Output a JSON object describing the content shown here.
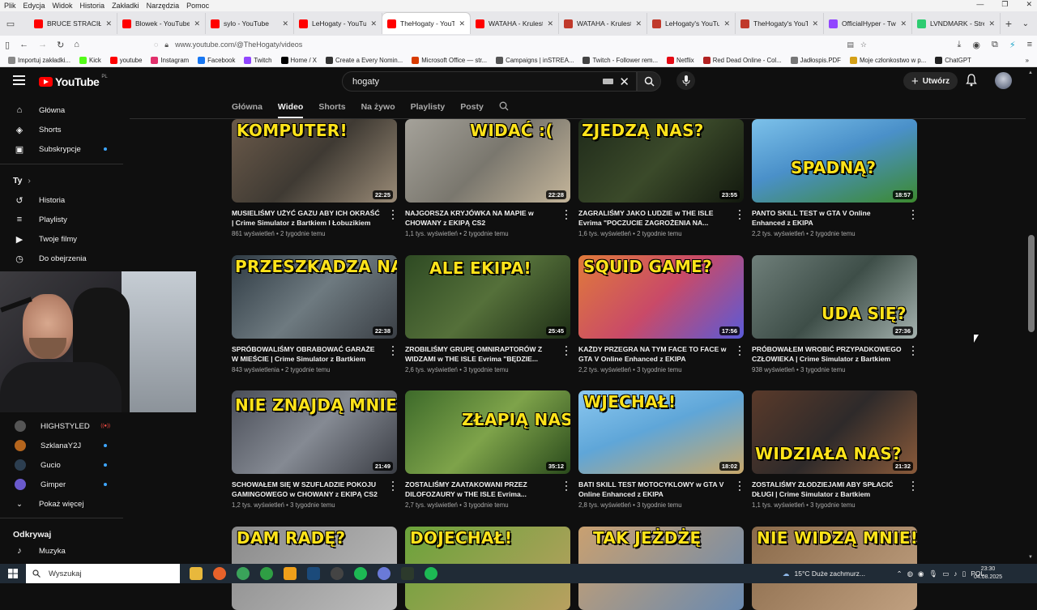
{
  "menubar": {
    "items": [
      "Plik",
      "Edycja",
      "Widok",
      "Historia",
      "Zakładki",
      "Narzędzia",
      "Pomoc"
    ]
  },
  "browser": {
    "tabs": [
      {
        "title": "BRUCE STRACIŁ KAS",
        "color": "#ff0000"
      },
      {
        "title": "Blowek - YouTube",
        "color": "#ff0000"
      },
      {
        "title": "sylo - YouTube",
        "color": "#ff0000"
      },
      {
        "title": "LeHogaty - YouTube",
        "color": "#ff0000"
      },
      {
        "title": "TheHogaty - YouTube",
        "color": "#ff0000",
        "active": true
      },
      {
        "title": "WATAHA - Krulestw",
        "color": "#ff0000"
      },
      {
        "title": "WATAHA - Krulestw",
        "color": "#c0392b"
      },
      {
        "title": "LeHogaty's YouTube",
        "color": "#c0392b"
      },
      {
        "title": "TheHogaty's YouTub",
        "color": "#c0392b"
      },
      {
        "title": "OfficialHyper - Twit",
        "color": "#9146ff"
      },
      {
        "title": "LVNDMARK - Strea",
        "color": "#2ecc71"
      }
    ],
    "url": "www.youtube.com/@TheHogaty/videos",
    "bookmarks": [
      {
        "label": "Importuj zakładki...",
        "color": "#888"
      },
      {
        "label": "Kick",
        "color": "#53fc18"
      },
      {
        "label": "youtube",
        "color": "#ff0000"
      },
      {
        "label": "Instagram",
        "color": "#e1306c"
      },
      {
        "label": "Facebook",
        "color": "#1877f2"
      },
      {
        "label": "Twitch",
        "color": "#9146ff"
      },
      {
        "label": "Home / X",
        "color": "#000000"
      },
      {
        "label": "Create a Every Nomin...",
        "color": "#333"
      },
      {
        "label": "Microsoft Office — str...",
        "color": "#d83b01"
      },
      {
        "label": "Campaigns | inSTREA...",
        "color": "#555"
      },
      {
        "label": "Twitch - Follower rem...",
        "color": "#444"
      },
      {
        "label": "Netflix",
        "color": "#e50914"
      },
      {
        "label": "Red Dead Online - Col...",
        "color": "#b22222"
      },
      {
        "label": "Jadłospis.PDF",
        "color": "#777"
      },
      {
        "label": "Moje członkostwo w p...",
        "color": "#d4a017"
      },
      {
        "label": "ChatGPT",
        "color": "#222"
      }
    ]
  },
  "youtube": {
    "logo_word": "YouTube",
    "logo_country": "PL",
    "search_value": "hogaty",
    "create_label": "Utwórz",
    "accent": "#ff0000"
  },
  "sidebar": {
    "main": [
      {
        "label": "Główna",
        "icon": "home-icon"
      },
      {
        "label": "Shorts",
        "icon": "shorts-icon"
      },
      {
        "label": "Subskrypcje",
        "icon": "subscriptions-icon",
        "dot": true
      }
    ],
    "you_heading": "Ty",
    "you": [
      {
        "label": "Historia",
        "icon": "history-icon"
      },
      {
        "label": "Playlisty",
        "icon": "playlists-icon"
      },
      {
        "label": "Twoje filmy",
        "icon": "your-videos-icon"
      },
      {
        "label": "Do obejrzenia",
        "icon": "watch-later-icon"
      }
    ],
    "channels": [
      {
        "label": "HIGHSTYLED",
        "live": true,
        "color": "#555"
      },
      {
        "label": "SzklanaY2J",
        "dot": true,
        "color": "#b5651d"
      },
      {
        "label": "Gucio",
        "dot": true,
        "color": "#2c3e50"
      },
      {
        "label": "Gimper",
        "dot": true,
        "color": "#6a5acd"
      }
    ],
    "more_label": "Pokaż więcej",
    "explore_heading": "Odkrywaj",
    "explore": [
      {
        "label": "Muzyka",
        "icon": "music-icon"
      }
    ]
  },
  "channel_tabs": [
    "Główna",
    "Wideo",
    "Shorts",
    "Na żywo",
    "Playlisty",
    "Posty"
  ],
  "videos": [
    {
      "caption": "KOMPUTER!",
      "duration": "22:25",
      "title": "MUSIELIŚMY UŻYĆ GAZU ABY ICH OKRAŚĆ | Crime Simulator z Bartkiem I Łobuzikiem",
      "views": "861 wyświetleń",
      "age": "2 tygodnie temu",
      "bg": "linear-gradient(135deg,#6b5a4a,#3f3a33 50%,#9a8b77)"
    },
    {
      "caption": "WIDAĆ :(",
      "duration": "22:28",
      "title": "NAJGORSZA KRYJÓWKA NA MAPIE w CHOWANY z EKIPĄ CS2",
      "views": "1,1 tys. wyświetleń",
      "age": "2 tygodnie temu",
      "bg": "linear-gradient(135deg,#a5a29a,#7a776e 50%,#c4b59a)"
    },
    {
      "caption": "ZJEDZĄ NAS?",
      "duration": "23:55",
      "title": "ZAGRALIŚMY JAKO LUDZIE w THE ISLE Evrima \"POCZUCIE ZAGROŻENIA NA...",
      "views": "1,6 tys. wyświetleń",
      "age": "2 tygodnie temu",
      "bg": "linear-gradient(135deg,#1f2a1a,#3b4a2a 50%,#12180e)"
    },
    {
      "caption": "SPADNĄ?",
      "duration": "18:57",
      "title": "PANTO SKILL TEST w GTA V Online Enhanced z EKIPA",
      "views": "2,2 tys. wyświetleń",
      "age": "2 tygodnie temu",
      "bg": "linear-gradient(160deg,#7cc1ea,#4a90c9 45%,#3c8a2e)"
    },
    {
      "caption": "PRZESZKADZA NAM!",
      "duration": "22:38",
      "title": "SPRÓBOWALIŚMY OBRABOWAĆ GARAŻE W MIEŚCIE | Crime Simulator z Bartkiem",
      "views": "843 wyświetlenia",
      "age": "2 tygodnie temu",
      "bg": "linear-gradient(135deg,#2f3b44,#6e7a80 50%,#3a3f45)"
    },
    {
      "caption": "ALE EKIPA!",
      "duration": "25:45",
      "title": "ZROBILIŚMY GRUPĘ OMNIRAPTORÓW Z WIDZAMI w THE ISLE Evrima \"BĘDZIE...",
      "views": "2,6 tys. wyświetleń",
      "age": "3 tygodnie temu",
      "bg": "linear-gradient(135deg,#2e4a23,#55703a 50%,#1e2e16)"
    },
    {
      "caption": "SQUID GAME?",
      "duration": "17:56",
      "title": "KAŻDY PRZEGRA NA TYM FACE TO FACE w GTA V Online Enhanced z EKIPA",
      "views": "2,2 tys. wyświetleń",
      "age": "3 tygodnie temu",
      "bg": "linear-gradient(135deg,#e07a3a,#c94a68 50%,#5a5ad8)"
    },
    {
      "caption": "UDA SIĘ?",
      "duration": "27:36",
      "title": "PRÓBOWAŁEM WROBIĆ PRZYPADKOWEGO CZŁOWIEKA | Crime Simulator z Bartkiem",
      "views": "938 wyświetleń",
      "age": "3 tygodnie temu",
      "bg": "linear-gradient(135deg,#6f7f7a,#3e4e48 50%,#a4b2ae)"
    },
    {
      "caption": "NIE ZNAJDĄ MNIE!",
      "duration": "21:49",
      "title": "SCHOWAŁEM SIĘ W SZUFLADZIE POKOJU GAMINGOWEGO w CHOWANY z EKIPĄ CS2",
      "views": "1,2 tys. wyświetleń",
      "age": "3 tygodnie temu",
      "bg": "linear-gradient(135deg,#4a4e58,#858a93 50%,#3a3d44)"
    },
    {
      "caption": "ZŁAPIĄ NAS?",
      "duration": "35:12",
      "title": "ZOSTALIŚMY ZAATAKOWANI PRZEZ DILOFOZAURY w THE ISLE Evrima...",
      "views": "2,7 tys. wyświetleń",
      "age": "3 tygodnie temu",
      "bg": "linear-gradient(135deg,#3d6a2a,#7ea34a 50%,#2a4a1c)"
    },
    {
      "caption": "WJECHAŁ!",
      "duration": "18:02",
      "title": "BATI SKILL TEST MOTOCYKLOWY w GTA V Online Enhanced z EKIPA",
      "views": "2,8 tys. wyświetleń",
      "age": "3 tygodnie temu",
      "bg": "linear-gradient(160deg,#8cc8f0,#5fa6d8 45%,#c9a86a)"
    },
    {
      "caption": "WIDZIAŁA NAS?",
      "duration": "21:32",
      "title": "ZOSTALIŚMY ZŁODZIEJAMI ABY SPŁACIĆ DŁUGI | Crime Simulator z Bartkiem",
      "views": "1,1 tys. wyświetleń",
      "age": "3 tygodnie temu",
      "bg": "linear-gradient(135deg,#5a3a2a,#2e2a2a 50%,#8a5a3a)"
    },
    {
      "caption": "DAM RADĘ?",
      "duration": "",
      "title": "",
      "views": "",
      "age": "",
      "bg": "linear-gradient(135deg,#8a8a8a,#bdbdbd)"
    },
    {
      "caption": "DOJECHAŁ!",
      "duration": "",
      "title": "",
      "views": "",
      "age": "",
      "bg": "linear-gradient(135deg,#6aa33a,#b8a060)"
    },
    {
      "caption": "TAK JEŻDŻĘ",
      "duration": "",
      "title": "",
      "views": "",
      "age": "",
      "bg": "linear-gradient(135deg,#c9a070,#6a8ab0)"
    },
    {
      "caption": "NIE WIDZĄ MNIE!",
      "duration": "",
      "title": "",
      "views": "",
      "age": "",
      "bg": "linear-gradient(135deg,#8a6a4a,#c0a080)"
    }
  ],
  "taskbar": {
    "search_placeholder": "Wyszukaj",
    "weather": "15°C  Duże zachmurz...",
    "lang": "POL",
    "time": "23:30",
    "date": "04.08.2025"
  }
}
